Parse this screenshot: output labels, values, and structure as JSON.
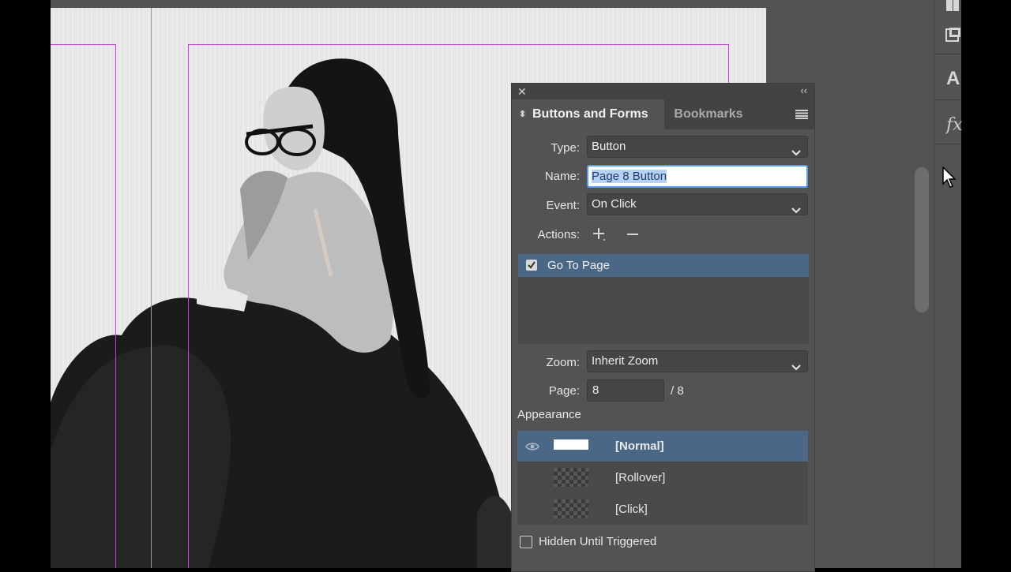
{
  "panel": {
    "tabs": [
      {
        "label": "Buttons and Forms"
      },
      {
        "label": "Bookmarks"
      }
    ],
    "type": {
      "label": "Type:",
      "value": "Button"
    },
    "name": {
      "label": "Name:",
      "value": "Page 8 Button"
    },
    "event": {
      "label": "Event:",
      "value": "On Click"
    },
    "actions": {
      "label": "Actions:",
      "items": [
        {
          "label": "Go To Page",
          "checked": true
        }
      ]
    },
    "zoom": {
      "label": "Zoom:",
      "value": "Inherit Zoom"
    },
    "page": {
      "label": "Page:",
      "value": "8",
      "total": "/ 8"
    },
    "appearance": {
      "heading": "Appearance",
      "states": [
        {
          "label": "[Normal]",
          "selected": true
        },
        {
          "label": "[Rollover]",
          "selected": false
        },
        {
          "label": "[Click]",
          "selected": false
        }
      ]
    },
    "hidden_until_triggered": {
      "label": "Hidden Until Triggered",
      "checked": false
    }
  },
  "tool_strip": {
    "items": [
      {
        "icon": "pages-icon"
      },
      {
        "icon": "links-icon"
      },
      {
        "icon": "character-icon",
        "glyph": "A"
      },
      {
        "icon": "effects-icon",
        "glyph": "fx"
      }
    ]
  },
  "colors": {
    "accent_selection": "#4b6786",
    "margin_guide": "#c33fd6",
    "panel_bg": "#535353"
  }
}
